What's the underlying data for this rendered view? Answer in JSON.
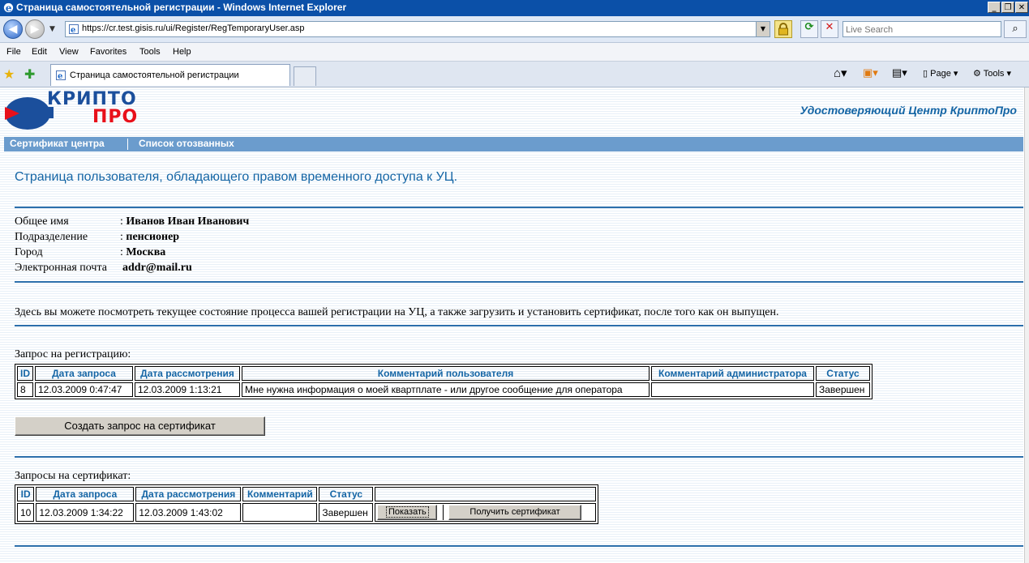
{
  "window": {
    "title": "Страница самостоятельной регистрации - Windows Internet Explorer",
    "buttons": {
      "minimize": "_",
      "maximize": "❐",
      "close": "✕"
    }
  },
  "address_bar": {
    "url": "https://cr.test.gisis.ru/ui/Register/RegTemporaryUser.asp",
    "search_placeholder": "Live Search"
  },
  "menu": [
    "File",
    "Edit",
    "View",
    "Favorites",
    "Tools",
    "Help"
  ],
  "tab": {
    "label": "Страница самостоятельной регистрации"
  },
  "command_bar": {
    "page_label": "Page",
    "tools_label": "Tools"
  },
  "site": {
    "logo_top": "КРИПТО",
    "logo_bottom": "ПРО",
    "uc_name": "Удостоверяющий Центр КриптоПро",
    "nav": [
      "Сертификат центра",
      "Список отозванных"
    ]
  },
  "page": {
    "heading": "Страница пользователя, обладающего правом временного доступа к УЦ.",
    "user": [
      {
        "label": "Общее имя",
        "value": "Иванов Иван Иванович"
      },
      {
        "label": "Подразделение",
        "value": "пенсионер"
      },
      {
        "label": "Город",
        "value": "Москва"
      },
      {
        "label": "Электронная почта",
        "value": "addr@mail.ru"
      }
    ],
    "description": "Здесь вы можете посмотреть текущее состояние процесса вашей регистрации на УЦ, а также загрузить и установить сертификат, после того как он выпущен.",
    "reg_request": {
      "caption": "Запрос на регистрацию:",
      "headers": [
        "ID",
        "Дата запроса",
        "Дата рассмотрения",
        "Комментарий пользователя",
        "Комментарий администратора",
        "Статус"
      ],
      "row": [
        "8",
        "12.03.2009 0:47:47",
        "12.03.2009 1:13:21",
        "Мне нужна информация о моей квартплате - или другое сообщение для оператора",
        "",
        "Завершен"
      ]
    },
    "create_cert_button": "Создать запрос на сертификат",
    "cert_requests": {
      "caption": "Запросы на сертификат:",
      "headers": [
        "ID",
        "Дата запроса",
        "Дата рассмотрения",
        "Комментарий",
        "Статус",
        ""
      ],
      "row": [
        "10",
        "12.03.2009 1:34:22",
        "12.03.2009 1:43:02",
        "",
        "Завершен"
      ],
      "show_button": "Показать",
      "get_cert_button": "Получить сертификат"
    }
  }
}
